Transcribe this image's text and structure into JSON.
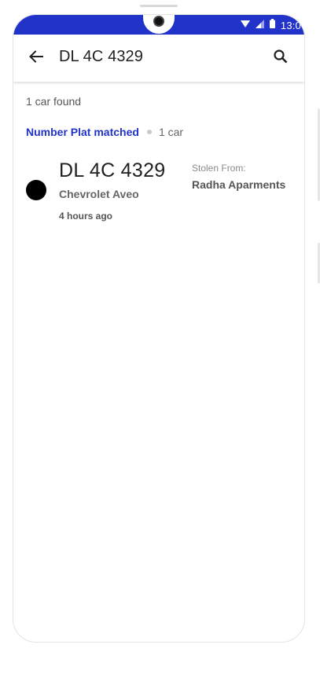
{
  "status_bar": {
    "time": "13:0",
    "color": "#2233c9",
    "icons": [
      "wifi-icon",
      "signal-icon",
      "battery-icon"
    ]
  },
  "app_bar": {
    "title": "DL 4C 4329",
    "back_icon": "arrow-back-icon",
    "search_icon": "search-icon"
  },
  "results": {
    "count_text": "1 car found",
    "group": {
      "title": "Number Plat matched",
      "count": "1 car",
      "title_color": "#2233c9"
    },
    "items": [
      {
        "plate": "DL 4C 4329",
        "model": "Chevrolet Aveo",
        "time_ago": "4 hours ago",
        "stolen_label": "Stolen From:",
        "stolen_location": "Radha Aparments",
        "dot_color": "#000000"
      }
    ]
  }
}
